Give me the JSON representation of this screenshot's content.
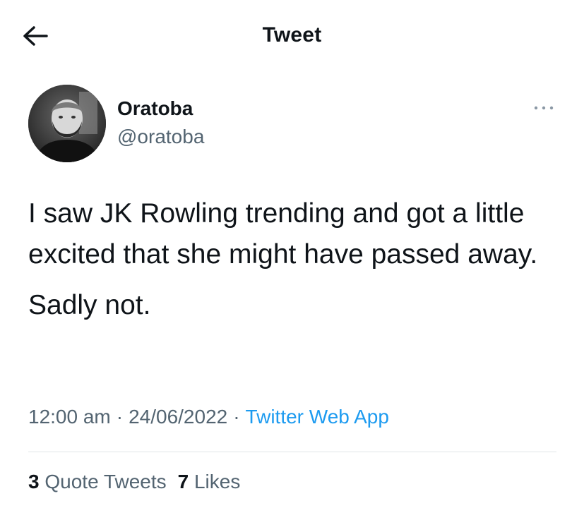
{
  "header": {
    "title": "Tweet",
    "back_icon": "arrow-left-icon"
  },
  "author": {
    "display_name": "Oratoba",
    "handle": "@oratoba",
    "avatar": "avatar-photo-bearded-man",
    "more_icon": "more-dots-icon"
  },
  "tweet": {
    "paragraphs": [
      "I saw JK Rowling trending and got a little excited that she might have passed away.",
      "Sadly not."
    ],
    "time": "12:00 am",
    "date": "24/06/2022",
    "separator": "·",
    "source": "Twitter Web App"
  },
  "stats": {
    "quote_tweets_count": "3",
    "quote_tweets_label": "Quote Tweets",
    "likes_count": "7",
    "likes_label": "Likes"
  },
  "colors": {
    "text": "#0f1419",
    "secondary": "#536471",
    "accent": "#1d9bf0"
  }
}
